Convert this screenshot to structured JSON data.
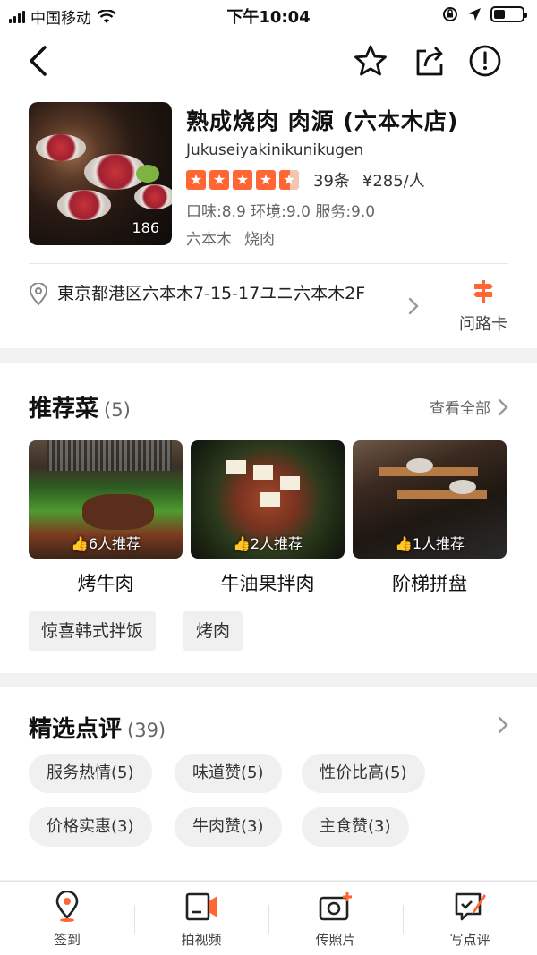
{
  "status": {
    "carrier": "中国移动",
    "time": "下午10:04"
  },
  "shop": {
    "name": "熟成烧肉 肉源 (六本木店)",
    "romaji": "Jukuseiyakinikunikugen",
    "photo_count": "186",
    "rating_stars": 4.5,
    "review_count": "39条",
    "price": "¥285/人",
    "scores": "口味:8.9 环境:9.0 服务:9.0",
    "tags": [
      "六本木",
      "烧肉"
    ],
    "address": "東京都港区六本木7-15-17ユニ六本木2F",
    "route_label": "问路卡"
  },
  "dishes": {
    "title": "推荐菜",
    "count": "(5)",
    "see_all": "查看全部",
    "items": [
      {
        "name": "烤牛肉",
        "recommend": "6人推荐"
      },
      {
        "name": "牛油果拌肉",
        "recommend": "2人推荐"
      },
      {
        "name": "阶梯拼盘",
        "recommend": "1人推荐"
      }
    ],
    "more": [
      "惊喜韩式拌饭",
      "烤肉"
    ]
  },
  "reviews": {
    "title": "精选点评",
    "count": "(39)",
    "tags": [
      "服务热情(5)",
      "味道赞(5)",
      "性价比高(5)",
      "价格实惠(3)",
      "牛肉赞(3)",
      "主食赞(3)"
    ]
  },
  "tabbar": {
    "items": [
      {
        "label": "签到",
        "icon": "location-pin-icon"
      },
      {
        "label": "拍视频",
        "icon": "video-camera-icon"
      },
      {
        "label": "传照片",
        "icon": "add-photo-icon"
      },
      {
        "label": "写点评",
        "icon": "write-review-icon"
      }
    ]
  },
  "colors": {
    "accent": "#ff6633",
    "text": "#111111",
    "muted": "#666666",
    "chip_bg": "#f0f0f0"
  }
}
